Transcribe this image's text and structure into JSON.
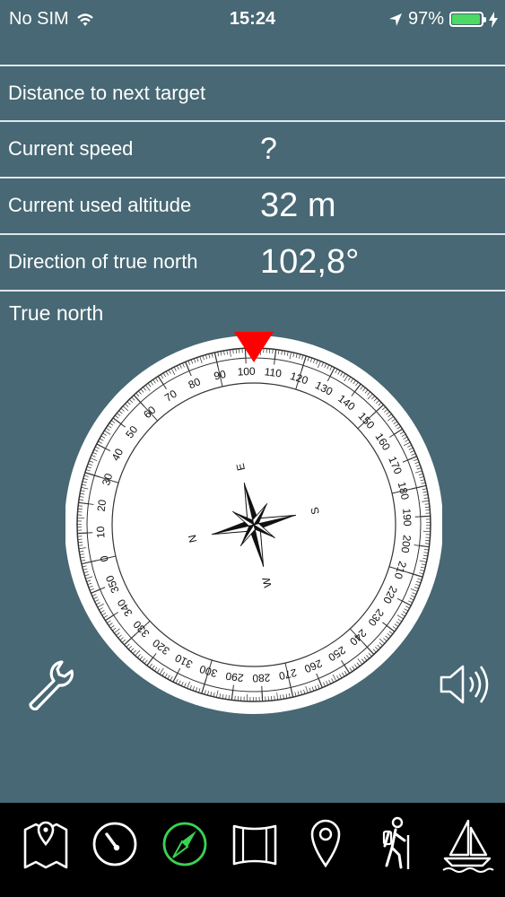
{
  "status_bar": {
    "carrier": "No SIM",
    "time": "15:24",
    "battery_percent": "97%",
    "battery_level": 0.97,
    "wifi_icon": "wifi-icon",
    "location_icon": "location-arrow-icon",
    "charging_icon": "charging-bolt-icon"
  },
  "info_rows": [
    {
      "label": "Distance to next target",
      "value": ""
    },
    {
      "label": "Current speed",
      "value": "?"
    },
    {
      "label": "Current used altitude",
      "value": "32 m"
    },
    {
      "label": "Direction of true north",
      "value": "102,8°"
    }
  ],
  "compass": {
    "title": "True north",
    "heading_degrees": 102.8,
    "inner_labels": {
      "n": "N",
      "e": "E",
      "s": "S",
      "w": "W"
    },
    "pointer_color": "#ff0000"
  },
  "buttons": {
    "settings_icon": "wrench-icon",
    "sound_icon": "speaker-icon"
  },
  "tabs": [
    {
      "icon": "map-icon",
      "active": false
    },
    {
      "icon": "speedometer-icon",
      "active": false
    },
    {
      "icon": "compass-icon",
      "active": true
    },
    {
      "icon": "panorama-icon",
      "active": false
    },
    {
      "icon": "location-pin-icon",
      "active": false
    },
    {
      "icon": "hiker-icon",
      "active": false
    },
    {
      "icon": "sailboat-icon",
      "active": false
    }
  ],
  "colors": {
    "background": "#476874",
    "tab_bar": "#000000",
    "active_tab": "#39d353",
    "battery": "#4cd964"
  }
}
